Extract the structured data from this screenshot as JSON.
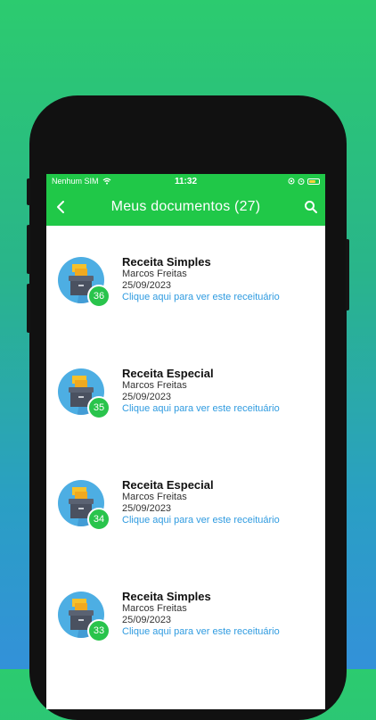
{
  "status_bar": {
    "carrier": "Nenhum SIM",
    "time": "11:32"
  },
  "header": {
    "title": "Meus documentos (27)"
  },
  "documents": [
    {
      "title": "Receita Simples",
      "doctor": "Marcos Freitas",
      "date": "25/09/2023",
      "link": "Clique aqui para ver este receituário",
      "badge": "36"
    },
    {
      "title": "Receita Especial",
      "doctor": "Marcos Freitas",
      "date": "25/09/2023",
      "link": "Clique aqui para ver este receituário",
      "badge": "35"
    },
    {
      "title": "Receita Especial",
      "doctor": "Marcos Freitas",
      "date": "25/09/2023",
      "link": "Clique aqui para ver este receituário",
      "badge": "34"
    },
    {
      "title": "Receita Simples",
      "doctor": "Marcos Freitas",
      "date": "25/09/2023",
      "link": "Clique aqui para ver este receituário",
      "badge": "33"
    }
  ],
  "colors": {
    "accent": "#20c848",
    "link": "#2f9be0",
    "badge": "#29c44c",
    "avatar_bg": "#4daee3"
  }
}
